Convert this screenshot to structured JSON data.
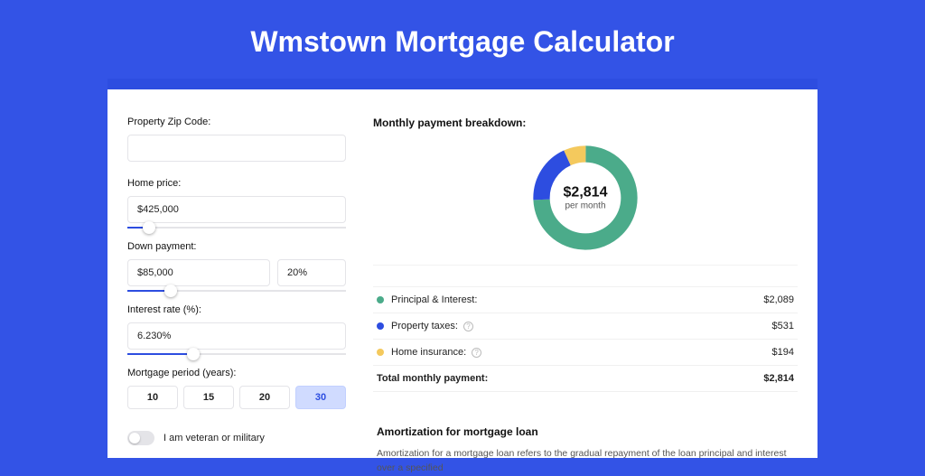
{
  "title": "Wmstown Mortgage Calculator",
  "colors": {
    "principal": "#4bab8a",
    "taxes": "#2d4de0",
    "insurance": "#f4c95d"
  },
  "form": {
    "zip": {
      "label": "Property Zip Code:",
      "value": ""
    },
    "price": {
      "label": "Home price:",
      "value": "$425,000",
      "slider_pct": 10
    },
    "down": {
      "label": "Down payment:",
      "value": "$85,000",
      "pct": "20%",
      "slider_pct": 20
    },
    "rate": {
      "label": "Interest rate (%):",
      "value": "6.230%",
      "slider_pct": 30
    },
    "period": {
      "label": "Mortgage period (years):",
      "options": [
        "10",
        "15",
        "20",
        "30"
      ],
      "active": "30"
    },
    "veteran": {
      "label": "I am veteran or military",
      "on": false
    }
  },
  "breakdown": {
    "title": "Monthly payment breakdown:",
    "center_amount": "$2,814",
    "center_sub": "per month",
    "items": [
      {
        "key": "principal",
        "label": "Principal & Interest:",
        "value": "$2,089",
        "info": false
      },
      {
        "key": "taxes",
        "label": "Property taxes:",
        "value": "$531",
        "info": true
      },
      {
        "key": "insurance",
        "label": "Home insurance:",
        "value": "$194",
        "info": true
      }
    ],
    "total_label": "Total monthly payment:",
    "total_value": "$2,814"
  },
  "amort": {
    "title": "Amortization for mortgage loan",
    "body": "Amortization for a mortgage loan refers to the gradual repayment of the loan principal and interest over a specified"
  },
  "chart_data": {
    "type": "pie",
    "title": "Monthly payment breakdown",
    "series": [
      {
        "name": "Principal & Interest",
        "value": 2089
      },
      {
        "name": "Property taxes",
        "value": 531
      },
      {
        "name": "Home insurance",
        "value": 194
      }
    ],
    "total": 2814,
    "center_label": "$2,814 per month"
  }
}
